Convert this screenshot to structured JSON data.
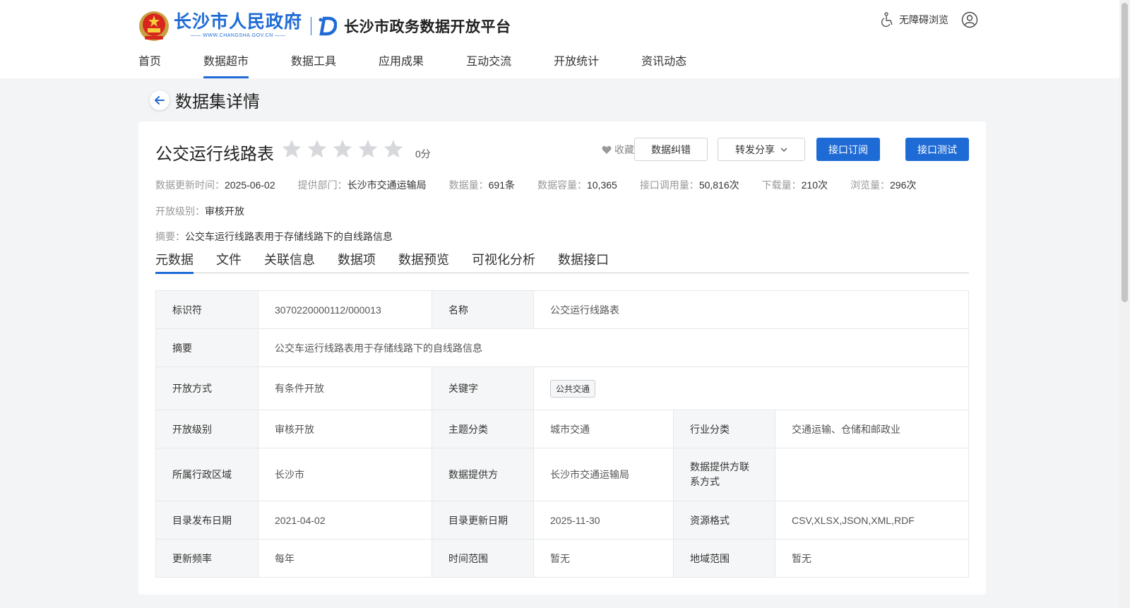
{
  "header": {
    "gov_name": "长沙市人民政府",
    "gov_url": "—— WWW.CHANGSHA.GOV.CN ——",
    "platform": "长沙市政务数据开放平台",
    "accessibility": "无障碍浏览"
  },
  "nav": [
    "首页",
    "数据超市",
    "数据工具",
    "应用成果",
    "互动交流",
    "开放统计",
    "资讯动态"
  ],
  "page_title": "数据集详情",
  "dataset": {
    "title": "公交运行线路表",
    "score": "0分",
    "rating": 0,
    "favorite": "收藏",
    "btn_correct": "数据纠错",
    "btn_share": "转发分享",
    "btn_subscribe": "接口订阅",
    "btn_test": "接口测试"
  },
  "meta": {
    "update_label": "数据更新时间：",
    "update_val": "2025-06-02",
    "dept_label": "提供部门：",
    "dept_val": "长沙市交通运输局",
    "count_label": "数据量：",
    "count_val": "691条",
    "size_label": "数据容量：",
    "size_val": "10,365",
    "api_label": "接口调用量：",
    "api_val": "50,816次",
    "dl_label": "下载量：",
    "dl_val": "210次",
    "view_label": "浏览量：",
    "view_val": "296次",
    "level_label": "开放级别：",
    "level_val": "审核开放",
    "summary_label": "摘要：",
    "summary_val": "公交车运行线路表用于存储线路下的自线路信息"
  },
  "tabs": [
    "元数据",
    "文件",
    "关联信息",
    "数据项",
    "数据预览",
    "可视化分析",
    "数据接口"
  ],
  "table": {
    "identifier_l": "标识符",
    "identifier_v": "3070220000112/000013",
    "name_l": "名称",
    "name_v": "公交运行线路表",
    "summary_l": "摘要",
    "summary_v": "公交车运行线路表用于存储线路下的自线路信息",
    "open_mode_l": "开放方式",
    "open_mode_v": "有条件开放",
    "keyword_l": "关键字",
    "keyword_v": "公共交通",
    "open_level_l": "开放级别",
    "open_level_v": "审核开放",
    "theme_l": "主题分类",
    "theme_v": "城市交通",
    "industry_l": "行业分类",
    "industry_v": "交通运输、仓储和邮政业",
    "region_l": "所属行政区域",
    "region_v": "长沙市",
    "provider_l": "数据提供方",
    "provider_v": "长沙市交通运输局",
    "contact_l": "数据提供方联系方式",
    "contact_v": "",
    "publish_l": "目录发布日期",
    "publish_v": "2021-04-02",
    "updated_l": "目录更新日期",
    "updated_v": "2025-11-30",
    "format_l": "资源格式",
    "format_v": "CSV,XLSX,JSON,XML,RDF",
    "freq_l": "更新频率",
    "freq_v": "每年",
    "time_l": "时间范围",
    "time_v": "暂无",
    "geo_l": "地域范围",
    "geo_v": "暂无"
  },
  "colors": {
    "brand": "#1f6bd6",
    "page_bg": "#f3f4f6"
  }
}
